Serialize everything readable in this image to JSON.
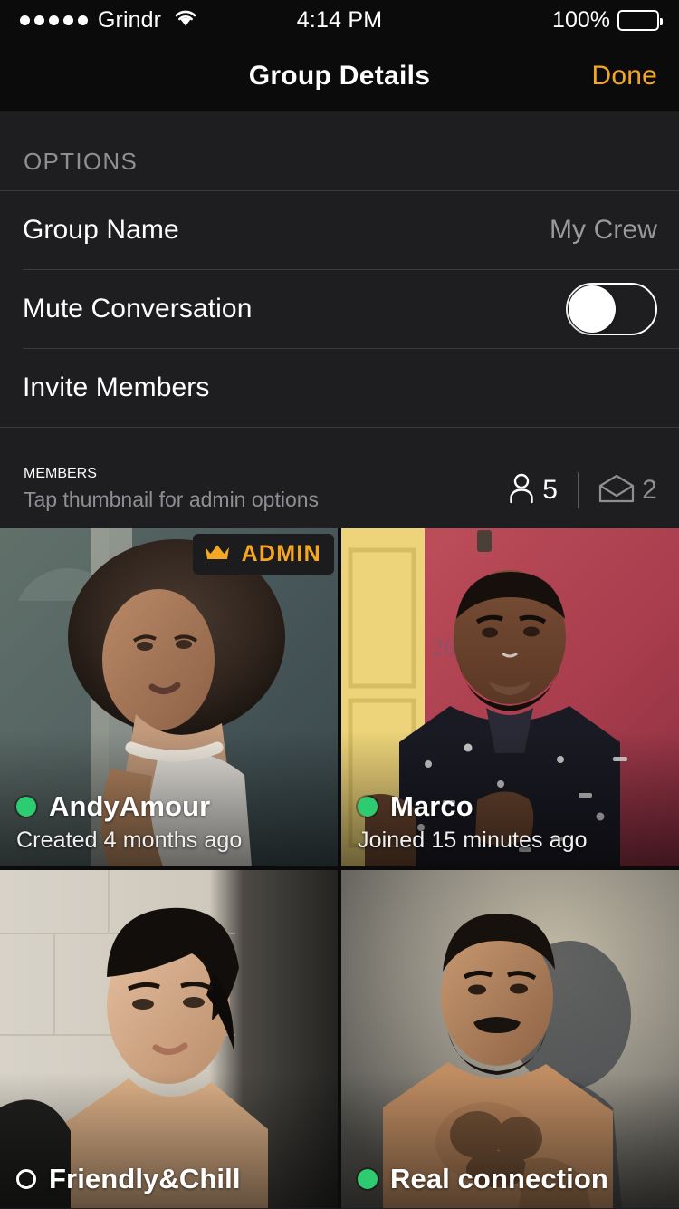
{
  "status_bar": {
    "signal_dots": 5,
    "carrier": "Grindr",
    "wifi_icon": "wifi-icon",
    "time": "4:14 PM",
    "battery_percent": "100%",
    "battery_icon": "battery-full-icon"
  },
  "nav": {
    "title": "Group Details",
    "done_label": "Done",
    "accent_color": "#f5a623"
  },
  "options_section": {
    "header": "OPTIONS",
    "rows": [
      {
        "label": "Group Name",
        "value": "My Crew",
        "type": "value"
      },
      {
        "label": "Mute Conversation",
        "type": "toggle",
        "toggle_on": false
      },
      {
        "label": "Invite Members",
        "type": "action"
      }
    ]
  },
  "members_section": {
    "header": "MEMBERS",
    "subtitle": "Tap thumbnail for admin options",
    "member_count": "5",
    "member_count_icon": "person-icon",
    "invite_count": "2",
    "invite_count_icon": "envelope-icon",
    "members": [
      {
        "name": "AndyAmour",
        "meta": "Created 4 months ago",
        "status": "online",
        "is_admin": true,
        "admin_label": "ADMIN",
        "admin_icon": "crown-icon"
      },
      {
        "name": "Marco",
        "meta": "Joined 15 minutes ago",
        "status": "online",
        "is_admin": false
      },
      {
        "name": "Friendly&Chill",
        "meta": "",
        "status": "offline",
        "is_admin": false
      },
      {
        "name": "Real connection",
        "meta": "",
        "status": "online",
        "is_admin": false
      }
    ]
  },
  "colors": {
    "background": "#1e1e20",
    "chrome": "#0b0b0c",
    "accent": "#f5a623",
    "online_green": "#2ecc71",
    "secondary_text": "#8e8e93",
    "divider": "#3a3a3c"
  }
}
